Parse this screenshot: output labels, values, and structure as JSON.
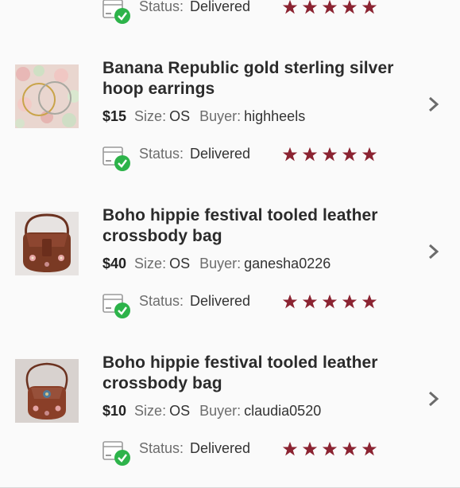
{
  "labels": {
    "size": "Size:",
    "buyer": "Buyer:",
    "status": "Status:"
  },
  "colors": {
    "star": "#8b2331",
    "check": "#2db34a",
    "chevron": "#6b6b6b"
  },
  "items": [
    {
      "title": "",
      "price": "",
      "size": "",
      "buyer": "",
      "status": "Delivered",
      "rating": 5
    },
    {
      "title": "Banana Republic gold sterling silver hoop earrings",
      "price": "$15",
      "size": "OS",
      "buyer": "highheels",
      "status": "Delivered",
      "rating": 5,
      "image": "hoop-earrings-photo"
    },
    {
      "title": "Boho hippie festival tooled leather crossbody bag",
      "price": "$40",
      "size": "OS",
      "buyer": "ganesha0226",
      "status": "Delivered",
      "rating": 5,
      "image": "leather-bag-photo"
    },
    {
      "title": "Boho hippie festival tooled leather crossbody bag",
      "price": "$10",
      "size": "OS",
      "buyer": "claudia0520",
      "status": "Delivered",
      "rating": 5,
      "image": "leather-bag-photo"
    }
  ]
}
